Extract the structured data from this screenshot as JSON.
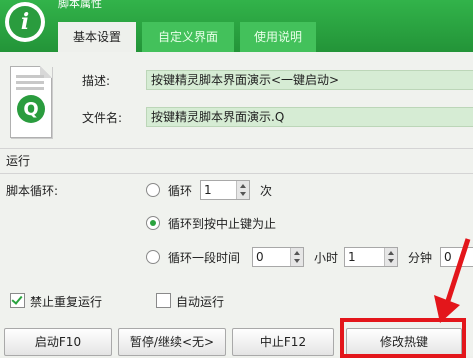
{
  "window": {
    "title": "脚本属性"
  },
  "tabs": [
    {
      "label": "基本设置",
      "active": true
    },
    {
      "label": "自定义界面",
      "active": false
    },
    {
      "label": "使用说明",
      "active": false
    }
  ],
  "icons": {
    "app": "info-logo-icon",
    "file": "script-file-icon"
  },
  "fields": {
    "description_label": "描述:",
    "description_value": "按键精灵脚本界面演示<一键启动>",
    "filename_label": "文件名:",
    "filename_value": "按键精灵脚本界面演示.Q"
  },
  "run": {
    "section_label": "运行",
    "loop_label": "脚本循环:",
    "option_loop": "循环",
    "loop_count": "1",
    "loop_unit": "次",
    "option_until_stop": "循环到按中止键为止",
    "option_duration": "循环一段时间",
    "hours_value": "0",
    "hours_unit": "小时",
    "minutes_value": "1",
    "minutes_unit": "分钟",
    "seconds_value": "0",
    "selected_option": "循环到按中止键为止"
  },
  "options": {
    "no_repeat_label": "禁止重复运行",
    "no_repeat_checked": true,
    "autorun_label": "自动运行",
    "autorun_checked": false
  },
  "buttons": {
    "start": "启动F10",
    "pause": "暂停/继续<无>",
    "stop": "中止F12",
    "hotkey": "修改热键"
  },
  "colors": {
    "header_green": "#2aa43f",
    "field_bg": "#d6ecd4",
    "highlight_red": "#e3161b"
  }
}
